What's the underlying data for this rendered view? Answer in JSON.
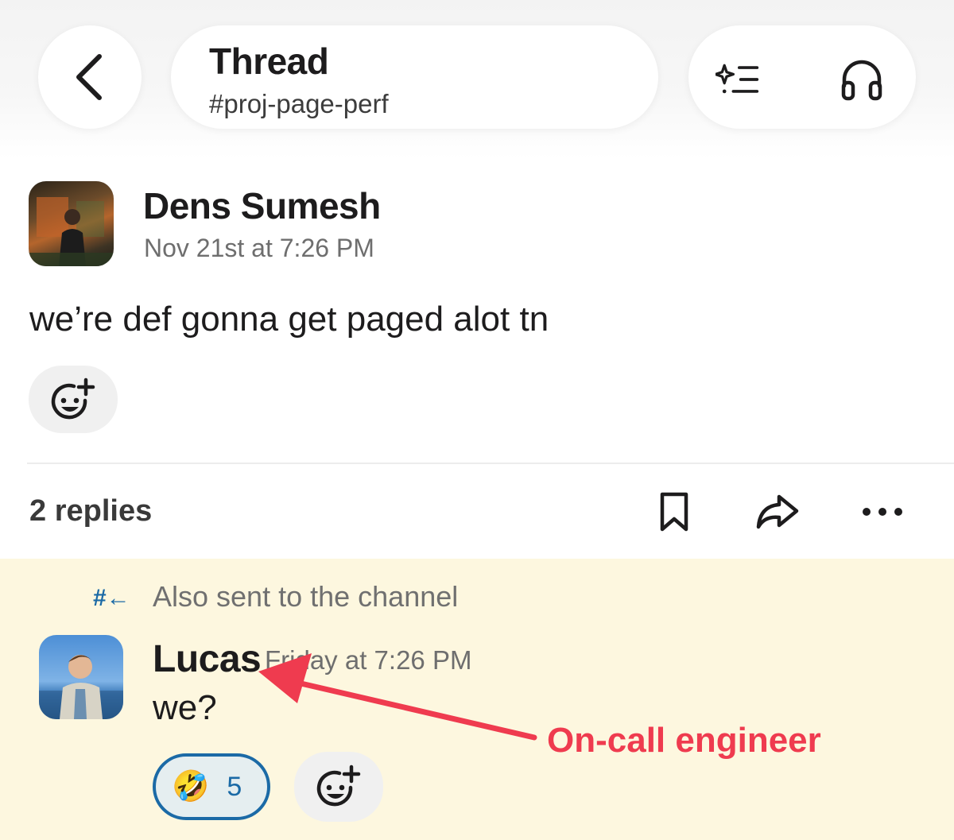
{
  "header": {
    "title": "Thread",
    "channel": "#proj-page-perf",
    "back_icon": "chevron-left-icon",
    "actions": [
      {
        "name": "ai-summary-icon"
      },
      {
        "name": "headphones-icon"
      }
    ]
  },
  "parent_message": {
    "author": "Dens Sumesh",
    "timestamp": "Nov 21st at 7:26 PM",
    "text": "we’re def gonna get paged alot tn"
  },
  "replies_bar": {
    "count_label": "2 replies",
    "tools": [
      "bookmark-icon",
      "share-icon",
      "more-icon"
    ]
  },
  "reply": {
    "also_sent_icon": "#←",
    "also_sent_label": "Also sent to the channel",
    "author": "Lucas",
    "timestamp": "Friday at 7:26 PM",
    "text": "we?",
    "reaction": {
      "emoji": "🤣",
      "count": "5"
    }
  },
  "annotation": {
    "label": "On-call engineer",
    "color": "#ef3b4f"
  },
  "colors": {
    "accent": "#1b6aa6",
    "highlight_bg": "#fdf7df"
  }
}
